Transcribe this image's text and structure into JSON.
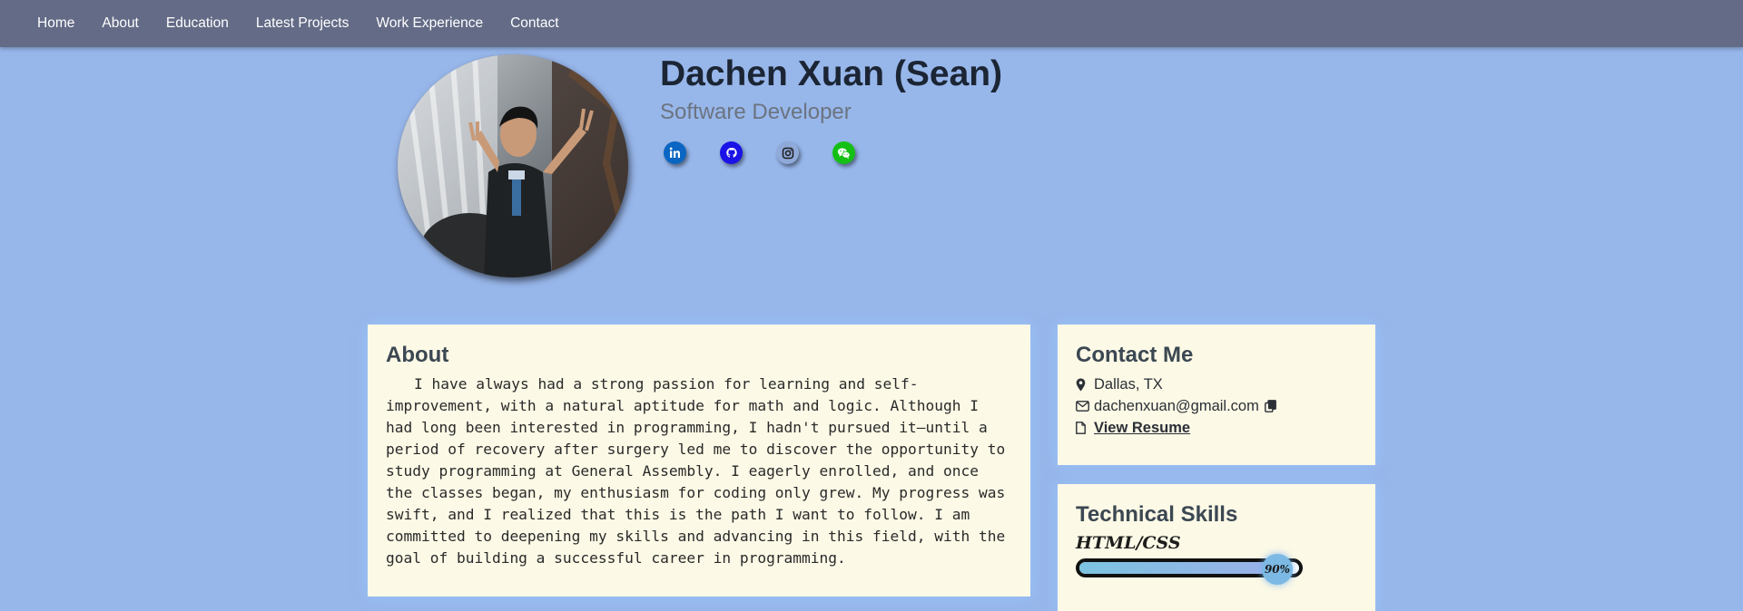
{
  "nav": {
    "items": [
      {
        "label": "Home"
      },
      {
        "label": "About"
      },
      {
        "label": "Education"
      },
      {
        "label": "Latest Projects"
      },
      {
        "label": "Work Experience"
      },
      {
        "label": "Contact"
      }
    ]
  },
  "profile": {
    "name": "Dachen Xuan (Sean)",
    "role": "Software Developer",
    "socials": [
      {
        "icon": "linkedin-icon",
        "color": "#0a66c2"
      },
      {
        "icon": "github-icon",
        "color": "#1a12e6"
      },
      {
        "icon": "instagram-icon",
        "color": "#8fa9d8"
      },
      {
        "icon": "wechat-icon",
        "color": "#15c015"
      }
    ]
  },
  "about": {
    "title": "About",
    "text": "I have always had a strong passion for learning and self-improvement, with a natural aptitude for math and logic. Although I had long been interested in programming, I hadn't pursued it—until a period of recovery after surgery led me to discover the opportunity to study programming at General Assembly. I eagerly enrolled, and once the classes began, my enthusiasm for coding only grew. My progress was swift, and I realized that this is the path I want to follow. I am committed to deepening my skills and advancing in this field, with the goal of building a successful career in programming."
  },
  "contact": {
    "title": "Contact Me",
    "location": "Dallas, TX",
    "email": "dachenxuan@gmail.com",
    "resume_label": "View Resume"
  },
  "skills": {
    "title": "Technical Skills",
    "items": [
      {
        "name": "HTML/CSS",
        "percent_label": "90%",
        "level": 0.9
      }
    ]
  },
  "colors": {
    "page_bg": "#97b6ea",
    "navbar_bg": "#636b86",
    "card_bg": "#fcf9e6"
  }
}
